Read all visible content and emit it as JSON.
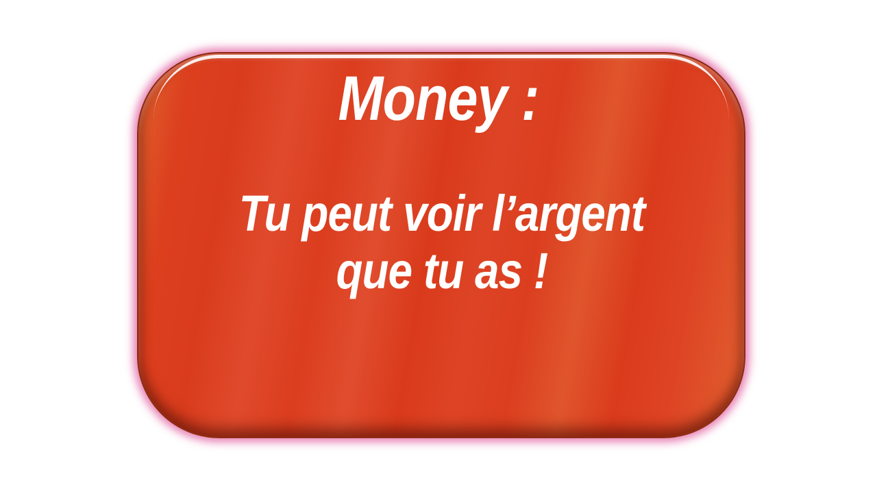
{
  "card": {
    "title": "Money :",
    "message_line1": "Tu peut voir l’argent",
    "message_line2": "que tu as !",
    "colors": {
      "fill": "#dc3f1e",
      "glow": "#d61f7a",
      "text": "#ffffff"
    }
  }
}
